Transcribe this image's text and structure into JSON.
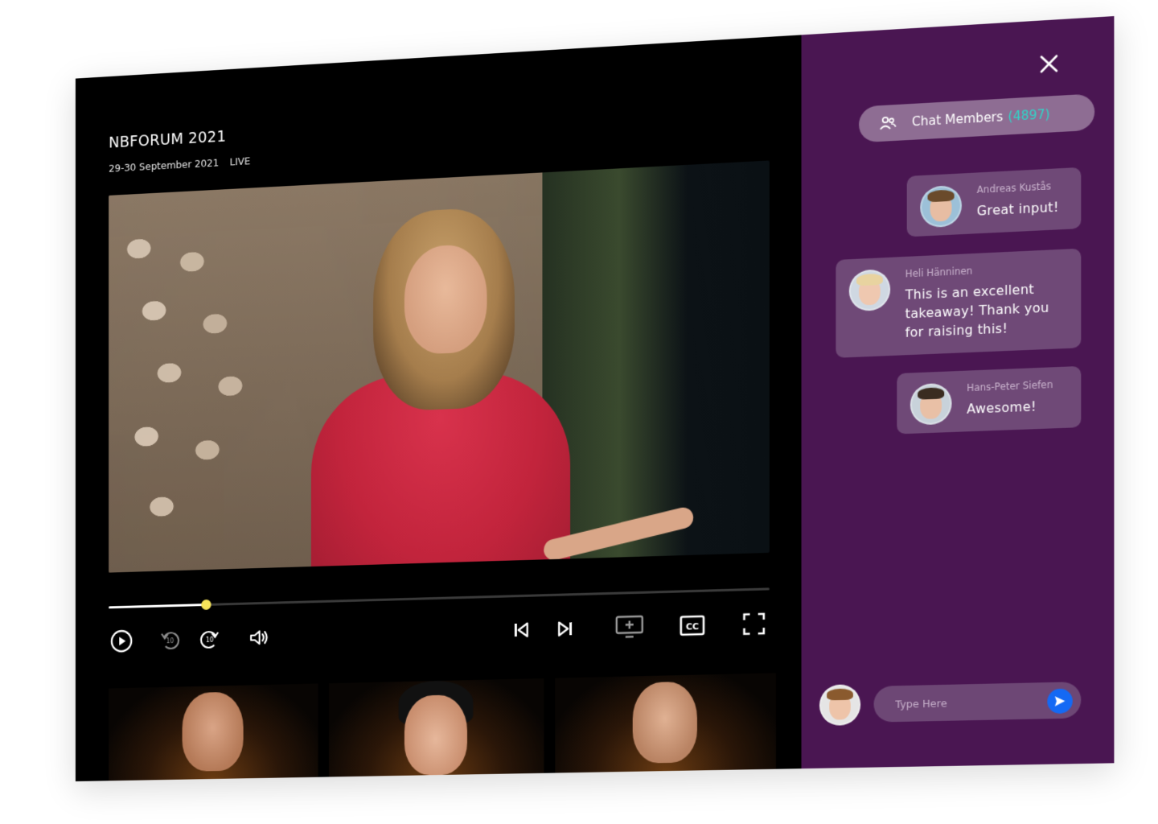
{
  "event": {
    "title": "NBFORUM 2021",
    "dates": "29-30 September 2021",
    "status": "LIVE"
  },
  "player": {
    "progress_fraction": 0.152,
    "controls": {
      "play": "play-icon",
      "rewind": "rewind-10-icon",
      "forward": "forward-10-icon",
      "volume": "volume-icon",
      "previous": "skip-previous-icon",
      "next": "skip-next-icon",
      "add_screen": "add-screen-icon",
      "captions": "closed-captions-icon",
      "fullscreen": "fullscreen-icon"
    },
    "rewind_seconds": "10",
    "forward_seconds": "10",
    "captions_label": "CC"
  },
  "chat": {
    "members_label": "Chat Members",
    "members_count": "(4897)",
    "accent_color": "#30d5c8",
    "messages": [
      {
        "author": "Andreas Kustås",
        "text": "Great input!"
      },
      {
        "author": "Heli Hänninen",
        "text": "This is an excellent takeaway! Thank you for raising this!"
      },
      {
        "author": "Hans-Peter Siefen",
        "text": "Awesome!"
      }
    ],
    "input_placeholder": "Type Here"
  },
  "colors": {
    "chat_background": "#4a1652",
    "bubble": "#6f4977",
    "progress_knob": "#f6e45a",
    "send_button": "#1469f4"
  }
}
